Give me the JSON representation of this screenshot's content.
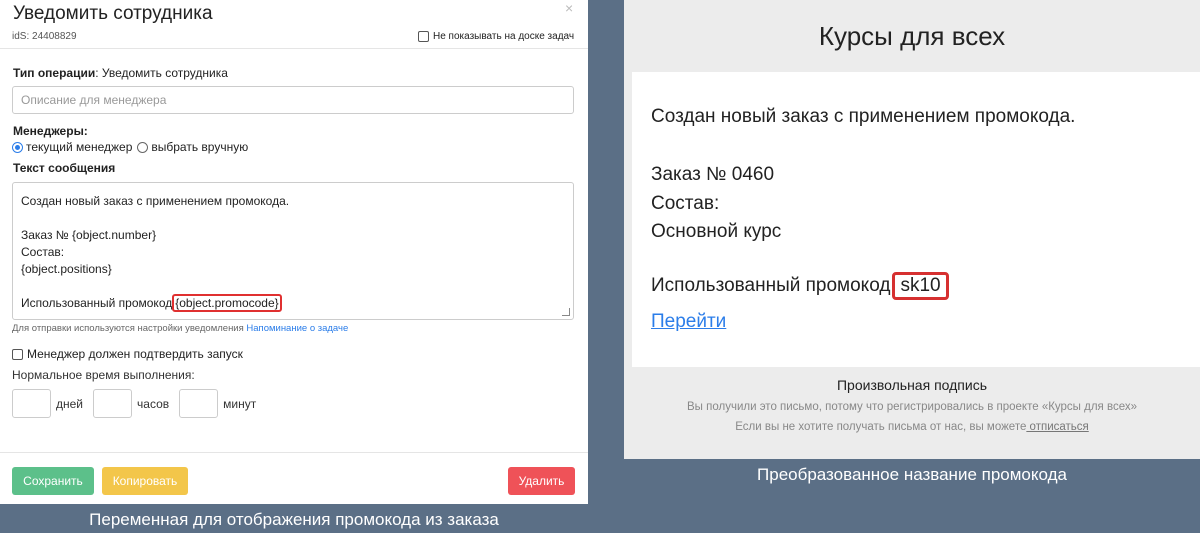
{
  "dialog": {
    "title": "Уведомить сотрудника",
    "close": "×",
    "ids": "idS: 24408829",
    "hide_on_board": "Не показывать на доске задач",
    "operation_label": "Тип операции",
    "operation_value": ": Уведомить сотрудника",
    "description_placeholder": "Описание для менеджера",
    "managers_label": "Менеджеры:",
    "radio_current": "текущий менеджер",
    "radio_manual": "выбрать вручную",
    "message_label": "Текст сообщения",
    "message_lines": {
      "l1": "Создан новый заказ с применением промокода.",
      "l2": "Заказ № {object.number}",
      "l3": "Состав:",
      "l4": "{object.positions}",
      "l5_prefix": "Использованный промокод",
      "l5_var": "{object.promocode}"
    },
    "hint_text": "Для отправки используются настройки уведомления ",
    "hint_link": "Напоминание о задаче",
    "confirm_label": "Менеджер должен подтвердить запуск",
    "normal_time_label": "Нормальное время выполнения:",
    "units": {
      "days": "дней",
      "hours": "часов",
      "minutes": "минут"
    },
    "buttons": {
      "save": "Сохранить",
      "copy": "Копировать",
      "delete": "Удалить"
    }
  },
  "caption_left": "Переменная для отображения промокода из заказа",
  "email": {
    "header": "Курсы для всех",
    "line1": "Создан новый заказ с применением промокода.",
    "order": "Заказ № 0460",
    "composition": "Состав:",
    "course": "Основной курс",
    "promo_prefix": "Использованный промокод",
    "promo_code": "sk10",
    "link": "Перейти",
    "signature": "Произвольная подпись",
    "note1": "Вы получили это письмо, потому что регистрировались в проекте «Курсы для всех»",
    "note2_prefix": "Если вы не хотите получать письма от нас, вы можете",
    "note2_link": " отписаться"
  },
  "caption_right": "Преобразованное название промокода",
  "colors": {
    "background": "#5b6f86",
    "save": "#5cc08a",
    "copy": "#f3c64a",
    "delete": "#ef5258",
    "highlight": "#e03030",
    "link": "#2b7de9"
  }
}
